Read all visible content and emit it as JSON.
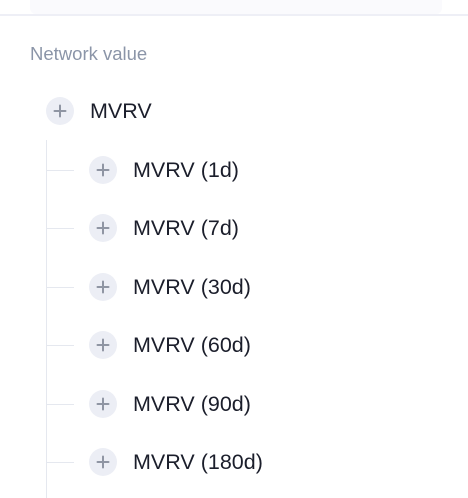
{
  "section": {
    "title": "Network value"
  },
  "tree": {
    "root": {
      "label": "MVRV",
      "icon": "plus-icon"
    },
    "children": [
      {
        "label": "MVRV (1d)",
        "icon": "plus-icon"
      },
      {
        "label": "MVRV (7d)",
        "icon": "plus-icon"
      },
      {
        "label": "MVRV (30d)",
        "icon": "plus-icon"
      },
      {
        "label": "MVRV (60d)",
        "icon": "plus-icon"
      },
      {
        "label": "MVRV (90d)",
        "icon": "plus-icon"
      },
      {
        "label": "MVRV (180d)",
        "icon": "plus-icon"
      }
    ]
  },
  "colors": {
    "text": "#1b1e2b",
    "muted_text": "#8b95a8",
    "icon_bg": "#eceef5",
    "tree_line": "#e5e8ef"
  }
}
